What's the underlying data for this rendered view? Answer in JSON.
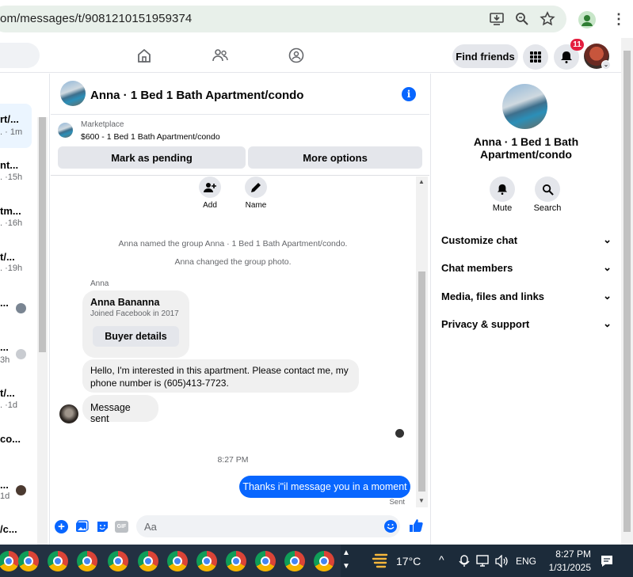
{
  "browser": {
    "url": "om/messages/t/9081210151959374"
  },
  "fbnav": {
    "find_friends": "Find friends",
    "notification_count": "11"
  },
  "left_list": {
    "items": [
      {
        "title": "rt/...",
        "sub": "1m",
        "sub_prefix": "."
      },
      {
        "title": "nt...",
        "sub": "15h",
        "sub_prefix": "."
      },
      {
        "title": "tm...",
        "sub": "16h",
        "sub_prefix": "."
      },
      {
        "title": "t/...",
        "sub": "19h",
        "sub_prefix": "."
      },
      {
        "title": "...",
        "sub": "",
        "sub_prefix": ""
      },
      {
        "title": "...",
        "sub": "3h",
        "sub_prefix": ""
      },
      {
        "title": "t/...",
        "sub": "1d",
        "sub_prefix": "."
      },
      {
        "title": "co...",
        "sub": "",
        "sub_prefix": ""
      },
      {
        "title": "...",
        "sub": "1d",
        "sub_prefix": ""
      },
      {
        "title": "/c...",
        "sub": "",
        "sub_prefix": ""
      }
    ]
  },
  "chat": {
    "title": "Anna · 1 Bed 1 Bath Apartment/condo",
    "marketplace_label": "Marketplace",
    "listing": "$600 - 1 Bed 1 Bath Apartment/condo",
    "mark_pending": "Mark as pending",
    "more_options": "More options",
    "add_label": "Add",
    "name_label": "Name",
    "sys1": "Anna named the group Anna · 1 Bed 1 Bath Apartment/condo.",
    "sys2": "Anna changed the group photo.",
    "sender": "Anna",
    "card_name": "Anna Bananna",
    "card_sub": "Joined Facebook in 2017",
    "buyer_details": "Buyer details",
    "msg1": "Hello, I'm interested in this apartment. Please contact me, my phone number is (605)413-7723.",
    "msg2": "Message sent",
    "time": "8:27 PM",
    "my_msg": "Thanks i\"il message you in a moment",
    "status": "Sent",
    "composer_placeholder": "Aa"
  },
  "right_panel": {
    "title": "Anna · 1 Bed 1 Bath Apartment/condo",
    "mute": "Mute",
    "search": "Search",
    "rows": [
      "Customize chat",
      "Chat members",
      "Media, files and links",
      "Privacy & support"
    ]
  },
  "taskbar": {
    "temperature": "17°C",
    "language": "ENG",
    "time": "8:27 PM",
    "date": "1/31/2025"
  },
  "colors": {
    "accent": "#0866ff",
    "badge": "#e41e3f"
  }
}
